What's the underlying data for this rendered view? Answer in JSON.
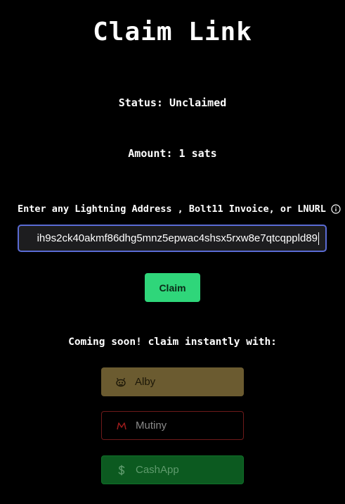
{
  "page": {
    "title": "Claim Link",
    "status": "Status: Unclaimed",
    "amount": "Amount: 1 sats"
  },
  "claim_form": {
    "label": "Enter any Lightning Address , Bolt11 Invoice, or LNURL",
    "info_icon": "info-icon",
    "input_value": "ih9s2ck40akmf86dhg5mnz5epwac4shsx5rxw8e7qtcqppld89",
    "submit_label": "Claim"
  },
  "coming_soon": {
    "heading": "Coming soon! claim instantly with:",
    "wallets": [
      {
        "label": "Alby",
        "icon": "alby-bee-icon",
        "color": "#6b5b30"
      },
      {
        "label": "Mutiny",
        "icon": "mutiny-icon",
        "color": "#6e1a1a"
      },
      {
        "label": "CashApp",
        "icon": "dollar-icon",
        "color": "#0c5a20"
      }
    ]
  },
  "colors": {
    "background": "#000000",
    "accent": "#2fd67a",
    "input_border": "#5a6bd4"
  }
}
